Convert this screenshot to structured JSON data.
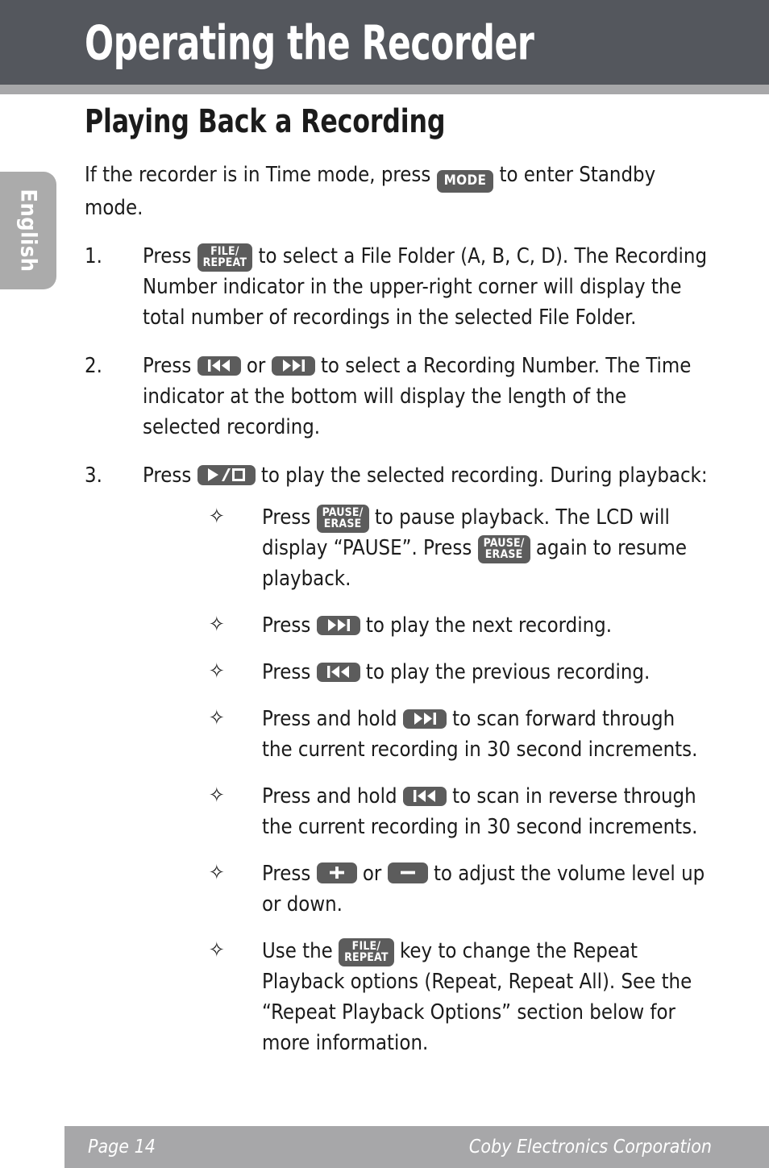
{
  "page": {
    "chapter_title": "Operating the Recorder",
    "language_tab": "English",
    "section_heading": "Playing Back a Recording"
  },
  "intro": {
    "before_key": "If the recorder is in Time mode, press",
    "key": "MODE",
    "after_key": "to enter Standby mode."
  },
  "keys": {
    "mode": "MODE",
    "file_repeat_line1": "FILE/",
    "file_repeat_line2": "REPEAT",
    "pause_erase_line1": "PAUSE/",
    "pause_erase_line2": "ERASE",
    "prev": "skip-backward-icon",
    "next": "skip-forward-icon",
    "play_stop": "play-stop-icon",
    "volume_up": "+",
    "volume_down": "–"
  },
  "steps": [
    {
      "number": "1.",
      "before_key": "Press",
      "after_key": "to select a File Folder (A, B, C, D). The Recording Number indicator in the upper-right corner will display the total number of recordings in the selected File Folder."
    },
    {
      "number": "2.",
      "before_key": "Press",
      "middle": "or",
      "after_key": "to select a Recording Number. The Time indicator at the bottom will display the length of the selected recording."
    },
    {
      "number": "3.",
      "before_key": "Press",
      "after_key": "to play the selected recording. During playback:"
    }
  ],
  "bullets": [
    {
      "bullet_glyph": "✧",
      "part1": "Press",
      "part2": "to pause playback. The LCD will display “PAUSE”. Press",
      "part3": "again to resume playback."
    },
    {
      "bullet_glyph": "✧",
      "part1": "Press",
      "part2": "to play the next recording."
    },
    {
      "bullet_glyph": "✧",
      "part1": "Press",
      "part2": "to play the previous recording."
    },
    {
      "bullet_glyph": "✧",
      "part1": "Press and hold",
      "part2": "to scan forward through the current recording in 30 second increments."
    },
    {
      "bullet_glyph": "✧",
      "part1": "Press and hold",
      "part2": "to scan in reverse through the current recording in 30 second increments."
    },
    {
      "bullet_glyph": "✧",
      "part1": "Press",
      "part2": "or",
      "part3": "to adjust the volume level up or down."
    },
    {
      "bullet_glyph": "✧",
      "part1": "Use the",
      "part2": "key to change the Repeat Playback options (Repeat, Repeat All). See the “Repeat Playback Options” section below for more information."
    }
  ],
  "footer": {
    "page_label": "Page 14",
    "company": "Coby Electronics Corporation"
  },
  "colors": {
    "header_bg": "#54575d",
    "header_rule": "#a7a7a9",
    "tab_bg": "#ababab",
    "key_bg": "#5c5c5c",
    "footer_bg": "#a7a7a9",
    "text": "#1b1b1b"
  }
}
